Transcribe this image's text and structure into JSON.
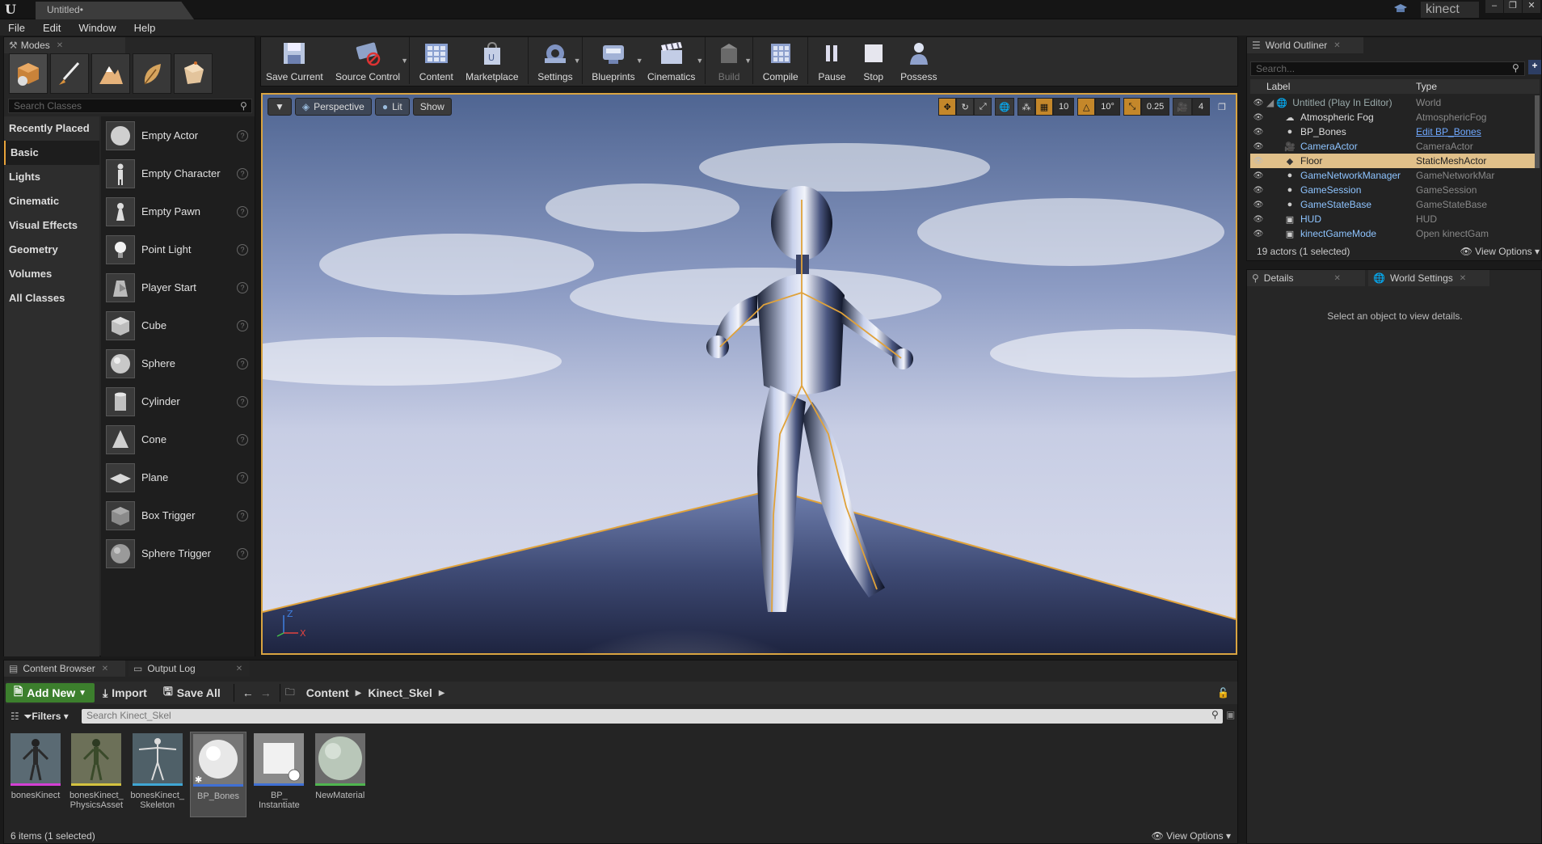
{
  "window": {
    "doc_tab": "Untitled•",
    "project": "kinect",
    "buttons": [
      "‒",
      "❐",
      "✕"
    ]
  },
  "menu": [
    "File",
    "Edit",
    "Window",
    "Help"
  ],
  "modes": {
    "tab": "Modes",
    "search_placeholder": "Search Classes",
    "categories": [
      "Recently Placed",
      "Basic",
      "Lights",
      "Cinematic",
      "Visual Effects",
      "Geometry",
      "Volumes",
      "All Classes"
    ],
    "items": [
      "Empty Actor",
      "Empty Character",
      "Empty Pawn",
      "Point Light",
      "Player Start",
      "Cube",
      "Sphere",
      "Cylinder",
      "Cone",
      "Plane",
      "Box Trigger",
      "Sphere Trigger"
    ]
  },
  "toolbar": {
    "save_current": "Save Current",
    "source_control": "Source Control",
    "content": "Content",
    "marketplace": "Marketplace",
    "settings": "Settings",
    "blueprints": "Blueprints",
    "cinematics": "Cinematics",
    "build": "Build",
    "compile": "Compile",
    "pause": "Pause",
    "stop": "Stop",
    "possess": "Possess"
  },
  "viewport": {
    "perspective": "Perspective",
    "lit": "Lit",
    "show": "Show",
    "grid_snap": "10",
    "rot_snap": "10°",
    "scale_snap": "0.25",
    "cam_speed": "4",
    "axis_z": "Z",
    "axis_x": "X"
  },
  "outliner": {
    "tab": "World Outliner",
    "search_placeholder": "Search...",
    "col_label": "Label",
    "col_type": "Type",
    "rows": [
      {
        "label": "Untitled (Play In Editor)",
        "type": "World"
      },
      {
        "label": "Atmospheric Fog",
        "type": "AtmosphericFog"
      },
      {
        "label": "BP_Bones",
        "type": "Edit BP_Bones"
      },
      {
        "label": "CameraActor",
        "type": "CameraActor"
      },
      {
        "label": "Floor",
        "type": "StaticMeshActor"
      },
      {
        "label": "GameNetworkManager",
        "type": "GameNetworkMar"
      },
      {
        "label": "GameSession",
        "type": "GameSession"
      },
      {
        "label": "GameStateBase",
        "type": "GameStateBase"
      },
      {
        "label": "HUD",
        "type": "HUD"
      },
      {
        "label": "kinectGameMode",
        "type": "Open kinectGam"
      }
    ],
    "status": "19 actors (1 selected)",
    "view_options": "View Options"
  },
  "details": {
    "tab": "Details",
    "tab2": "World Settings",
    "message": "Select an object to view details."
  },
  "content_browser": {
    "tab": "Content Browser",
    "tab2": "Output Log",
    "add_new": "Add New",
    "import": "Import",
    "save_all": "Save All",
    "crumb1": "Content",
    "crumb2": "Kinect_Skel",
    "filters": "Filters",
    "search_placeholder": "Search Kinect_Skel",
    "assets": [
      {
        "name": "bonesKinect",
        "color": "#d43fd4"
      },
      {
        "name": "bonesKinect_ PhysicsAsset",
        "color": "#d4c23f"
      },
      {
        "name": "bonesKinect_ Skeleton",
        "color": "#3fa6d4"
      },
      {
        "name": "BP_Bones",
        "color": "#3f6fd4"
      },
      {
        "name": "BP_ Instantiate",
        "color": "#3f6fd4"
      },
      {
        "name": "NewMaterial",
        "color": "#4fb54f"
      }
    ],
    "status": "6 items (1 selected)",
    "view_options": "View Options"
  }
}
